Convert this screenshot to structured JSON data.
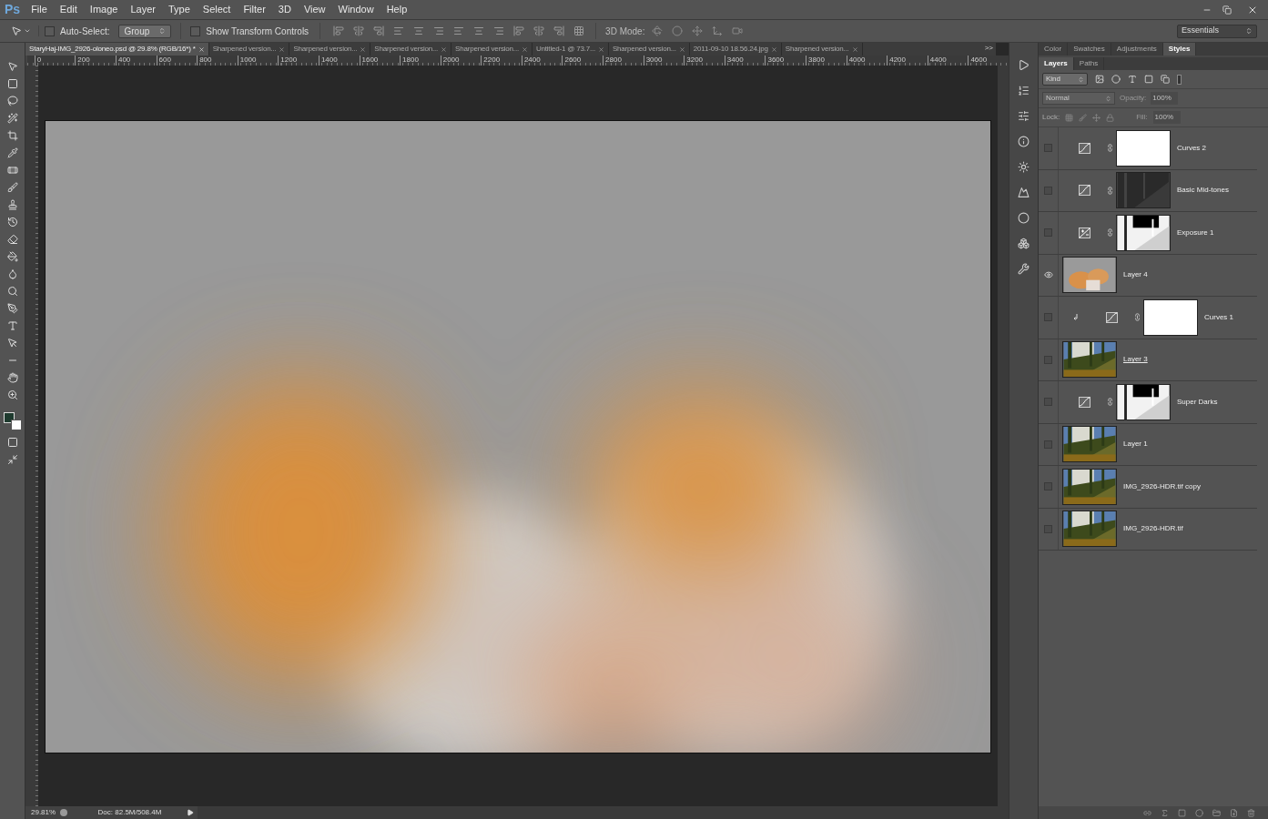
{
  "app_logo": "Ps",
  "menu": [
    "File",
    "Edit",
    "Image",
    "Layer",
    "Type",
    "Select",
    "Filter",
    "3D",
    "View",
    "Window",
    "Help"
  ],
  "options_bar": {
    "auto_select": {
      "label": "Auto-Select:",
      "checked": false
    },
    "auto_select_target": "Group",
    "show_transform": {
      "label": "Show Transform Controls",
      "checked": false
    },
    "mode_label": "3D Mode:",
    "workspace": "Essentials"
  },
  "document_tabs": [
    {
      "title": "StaryHaj-IMG_2926-oloneo.psd @ 29.8% (RGB/16*) *",
      "selected": true
    },
    {
      "title": "Sharpened version...",
      "selected": false
    },
    {
      "title": "Sharpened version...",
      "selected": false
    },
    {
      "title": "Sharpened version...",
      "selected": false
    },
    {
      "title": "Sharpened version...",
      "selected": false
    },
    {
      "title": "Untitled-1 @ 73.7...",
      "selected": false
    },
    {
      "title": "Sharpened version...",
      "selected": false
    },
    {
      "title": "2011-09-10 18.56.24.jpg",
      "selected": false
    },
    {
      "title": "Sharpened version...",
      "selected": false
    }
  ],
  "tabs_overflow": ">>",
  "ruler": [
    "0",
    "200",
    "400",
    "600",
    "800",
    "1000",
    "1200",
    "1400",
    "1600",
    "1800",
    "2000",
    "2200",
    "2400",
    "2600",
    "2800",
    "3000",
    "3200",
    "3400",
    "3600",
    "3800",
    "4000",
    "4200",
    "4400",
    "4600"
  ],
  "panel_tabs": [
    {
      "label": "Color",
      "selected": false
    },
    {
      "label": "Swatches",
      "selected": false
    },
    {
      "label": "Adjustments",
      "selected": false
    },
    {
      "label": "Styles",
      "selected": true
    }
  ],
  "layers_panel": {
    "tabs": [
      {
        "label": "Layers",
        "selected": true
      },
      {
        "label": "Paths",
        "selected": false
      }
    ],
    "filter": "Kind",
    "blend_mode": "Normal",
    "opacity_label": "Opacity:",
    "opacity": "100%",
    "lock_label": "Lock:",
    "fill_label": "Fill:",
    "fill": "100%",
    "layers": [
      {
        "name": "Curves 2",
        "kind": "adjustment",
        "icon": {
          "kind": "curves"
        },
        "mask": {
          "kind": "white"
        },
        "visible": false,
        "clipped": false,
        "underlined": false
      },
      {
        "name": "Basic Mid-tones",
        "kind": "adjustment",
        "icon": {
          "kind": "curves"
        },
        "mask": {
          "kind": "dark"
        },
        "visible": false,
        "clipped": false,
        "underlined": false
      },
      {
        "name": "Exposure 1",
        "kind": "adjustment",
        "icon": {
          "kind": "exposure"
        },
        "mask": {
          "kind": "contrast"
        },
        "visible": false,
        "clipped": false,
        "underlined": false
      },
      {
        "name": "Layer 4",
        "kind": "pixel",
        "thumb": {
          "kind": "blur"
        },
        "visible": true,
        "clipped": false,
        "underlined": false
      },
      {
        "name": "Curves 1",
        "kind": "adjustment",
        "icon": {
          "kind": "curves"
        },
        "mask": {
          "kind": "white"
        },
        "visible": false,
        "clipped": true,
        "underlined": false
      },
      {
        "name": "Layer 3",
        "kind": "pixel",
        "thumb": {
          "kind": "forest"
        },
        "visible": false,
        "clipped": false,
        "underlined": true
      },
      {
        "name": "Super Darks",
        "kind": "adjustment",
        "icon": {
          "kind": "curves"
        },
        "mask": {
          "kind": "contrast"
        },
        "visible": false,
        "clipped": false,
        "underlined": false
      },
      {
        "name": "Layer 1",
        "kind": "pixel",
        "thumb": {
          "kind": "forest"
        },
        "visible": false,
        "clipped": false,
        "underlined": false
      },
      {
        "name": "IMG_2926-HDR.tif copy",
        "kind": "pixel",
        "thumb": {
          "kind": "forest"
        },
        "visible": false,
        "clipped": false,
        "underlined": false
      },
      {
        "name": "IMG_2926-HDR.tif",
        "kind": "pixel",
        "thumb": {
          "kind": "forest"
        },
        "visible": false,
        "clipped": false,
        "underlined": false
      }
    ]
  },
  "status_bar": {
    "zoom": "29.81%",
    "doc": "Doc: 82.5M/508.4M"
  }
}
